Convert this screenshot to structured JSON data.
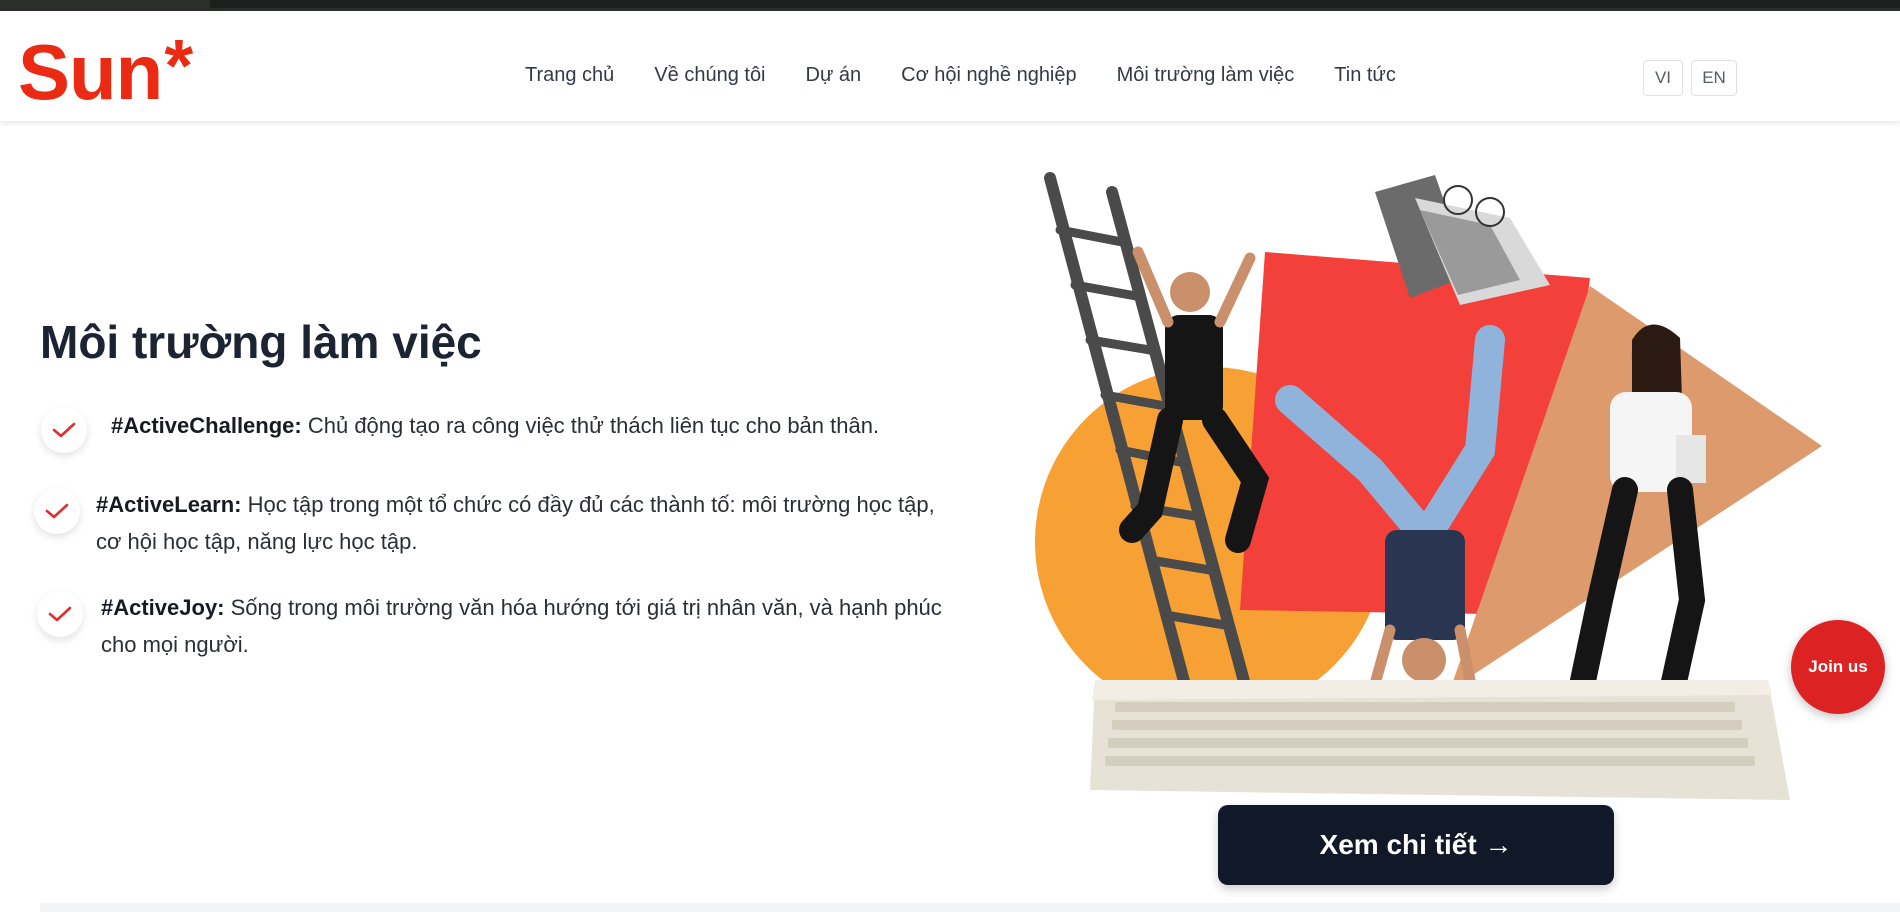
{
  "brand": {
    "logo_text": "Sun",
    "logo_star": "*",
    "color": "#ea2a13"
  },
  "nav": {
    "items": [
      {
        "label": "Trang chủ"
      },
      {
        "label": "Về chúng tôi"
      },
      {
        "label": "Dự án"
      },
      {
        "label": "Cơ hội nghề nghiệp"
      },
      {
        "label": "Môi trường làm việc"
      },
      {
        "label": "Tin tức"
      }
    ]
  },
  "languages": {
    "vi": "VI",
    "en": "EN"
  },
  "section": {
    "title": "Môi trường làm việc",
    "features": [
      {
        "tag": "#ActiveChallenge:",
        "text": " Chủ động tạo ra công việc thử thách liên tục cho bản thân."
      },
      {
        "tag": "#ActiveLearn:",
        "text": " Học tập trong một tổ chức có đầy đủ các thành tố: môi trường học tập, cơ hội học tập, năng lực học tập."
      },
      {
        "tag": "#ActiveJoy:",
        "text": " Sống trong môi trường văn hóa hướng tới giá trị nhân văn, và hạnh phúc cho mọi người."
      }
    ],
    "check_color": "#e02d2d"
  },
  "cta": {
    "label": "Xem chi tiết →"
  },
  "floating": {
    "join_label": "Join us"
  },
  "illustration": {
    "icon": "workplace-collage-image",
    "shapes": {
      "circle": "#f7a135",
      "square": "#f4403a",
      "triangle": "#dd9a6c"
    }
  }
}
